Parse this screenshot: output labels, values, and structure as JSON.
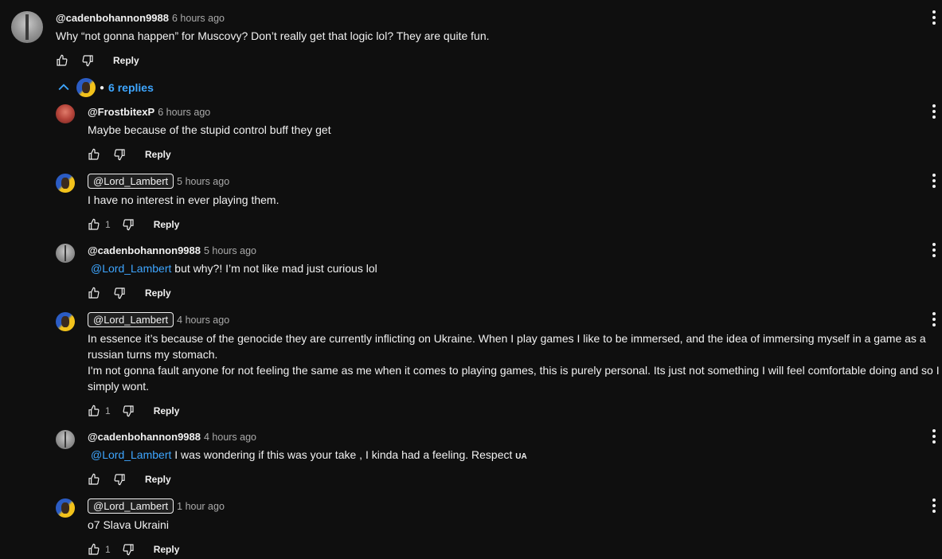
{
  "top_comment": {
    "author": "@cadenbohannon9988",
    "time": "6 hours ago",
    "text": "Why “not gonna happen” for Muscovy?  Don’t really get that logic lol?  They are quite fun.",
    "reply_label": "Reply",
    "avatar_icon": "gray-photo-avatar-icon"
  },
  "replies_toggle": {
    "label": "6 replies"
  },
  "replies": [
    {
      "author": "@FrostbitexP",
      "time": "6 hours ago",
      "text": "Maybe because of the stupid control buff they get",
      "likes": "",
      "reply_label": "Reply"
    },
    {
      "author": "@Lord_Lambert",
      "time": "5 hours ago",
      "text": "I have no interest in ever playing them.",
      "likes": "1",
      "reply_label": "Reply"
    },
    {
      "author": "@cadenbohannon9988",
      "time": "5 hours ago",
      "mention": "@Lord_Lambert",
      "text": " but why?!  I’m not like mad just curious lol",
      "likes": "",
      "reply_label": "Reply"
    },
    {
      "author": "@Lord_Lambert",
      "time": "4 hours ago",
      "text_line1": "In essence it’s because of the genocide they are currently inflicting on Ukraine. When I play games I like to be immersed, and the idea of immersing myself in a game as a",
      "text_line2": "russian turns my stomach.",
      "text_line3": "I'm not gonna fault anyone for not feeling the same as me when it comes to playing games, this is purely personal. Its just not something I will feel comfortable doing and so I",
      "text_line4": "simply wont.",
      "likes": "1",
      "reply_label": "Reply"
    },
    {
      "author": "@cadenbohannon9988",
      "time": "4 hours ago",
      "mention": "@Lord_Lambert",
      "text": " I was wondering if this was your take , I kinda had a feeling.  Respect ",
      "flag_text": "UA",
      "likes": "",
      "reply_label": "Reply"
    },
    {
      "author": "@Lord_Lambert",
      "time": "1 hour ago",
      "text": "o7 Slava Ukraini",
      "likes": "1",
      "reply_label": "Reply"
    }
  ],
  "colors": {
    "background": "#0f0f0f",
    "text": "#f1f1f1",
    "secondary": "#aaaaaa",
    "link": "#3ea6ff"
  }
}
